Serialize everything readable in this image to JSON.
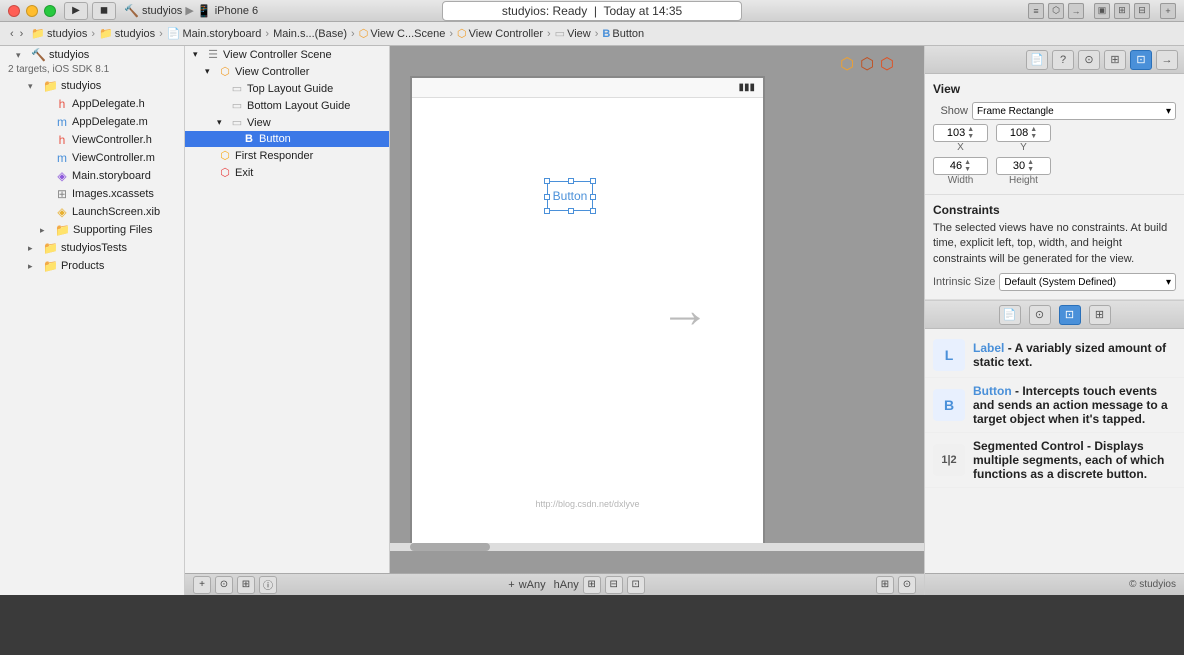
{
  "titlebar": {
    "title": "Main.storyboard"
  },
  "toolbar": {
    "app_name": "studyios",
    "device": "iPhone 6",
    "status": "studyios: Ready",
    "time": "Today at 14:35"
  },
  "breadcrumb": {
    "items": [
      "studyios",
      "studyios",
      "Main.storyboard",
      "Main.s...(Base)",
      "View C...Scene",
      "View Controller",
      "View",
      "B Button"
    ]
  },
  "file_nav": {
    "root": {
      "name": "studyios",
      "subtitle": "2 targets, iOS SDK 8.1",
      "children": [
        {
          "name": "studyios",
          "type": "group",
          "open": true,
          "children": [
            {
              "name": "AppDelegate.h",
              "type": "h"
            },
            {
              "name": "AppDelegate.m",
              "type": "m"
            },
            {
              "name": "ViewController.h",
              "type": "h"
            },
            {
              "name": "ViewController.m",
              "type": "m"
            },
            {
              "name": "Main.storyboard",
              "type": "storyboard"
            },
            {
              "name": "Images.xcassets",
              "type": "xcassets"
            },
            {
              "name": "LaunchScreen.xib",
              "type": "xib"
            },
            {
              "name": "Supporting Files",
              "type": "group"
            }
          ]
        },
        {
          "name": "studyiosTests",
          "type": "group"
        },
        {
          "name": "Products",
          "type": "group"
        }
      ]
    }
  },
  "scene_tree": {
    "items": [
      {
        "label": "View Controller Scene",
        "type": "scene",
        "level": 1
      },
      {
        "label": "View Controller",
        "type": "viewcontroller",
        "level": 2
      },
      {
        "label": "Top Layout Guide",
        "type": "guide",
        "level": 3
      },
      {
        "label": "Bottom Layout Guide",
        "type": "guide",
        "level": 3
      },
      {
        "label": "View",
        "type": "view",
        "level": 3
      },
      {
        "label": "Button",
        "type": "button",
        "level": 4,
        "selected": true
      },
      {
        "label": "First Responder",
        "type": "responder",
        "level": 2
      },
      {
        "label": "Exit",
        "type": "exit",
        "level": 2
      }
    ]
  },
  "canvas": {
    "button_label": "Button",
    "watermark": "http://blog.csdn.net/dxlyve",
    "arrow": "→"
  },
  "inspector": {
    "section_title": "View",
    "show_label": "Show",
    "show_value": "Frame Rectangle",
    "x_value": "103",
    "y_value": "108",
    "x_label": "X",
    "y_label": "Y",
    "width_value": "46",
    "height_value": "30",
    "width_label": "Width",
    "height_label": "Height",
    "constraints_title": "Constraints",
    "constraints_text": "The selected views have no constraints. At build time, explicit left, top, width, and height constraints will be generated for the view.",
    "intrinsic_label": "Intrinsic Size",
    "intrinsic_value": "Default (System Defined)"
  },
  "object_library": {
    "items": [
      {
        "name": "Label",
        "icon": "L",
        "icon_color": "#4a90d9",
        "description": "Label - A variably sized amount of static text."
      },
      {
        "name": "Button",
        "icon": "B",
        "icon_color": "#4a90d9",
        "description": "Button - Intercepts touch events and sends an action message to a target object when it's tapped."
      },
      {
        "name": "Segmented Control",
        "icon": "12",
        "icon_color": "#888",
        "description": "Segmented Control - Displays multiple segments, each of which functions as a discrete button."
      }
    ]
  },
  "bottom_bar": {
    "size_class": "wAny",
    "height_class": "hAny"
  }
}
